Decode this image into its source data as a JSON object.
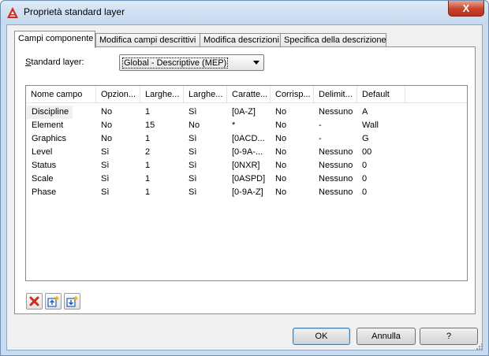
{
  "window": {
    "title": "Proprietà standard layer",
    "close_symbol": "X"
  },
  "tabs": [
    {
      "label": "Campi componente",
      "active": true
    },
    {
      "label": "Modifica campi descrittivi",
      "active": false
    },
    {
      "label": "Modifica descrizioni",
      "active": false
    },
    {
      "label": "Specifica della descrizione",
      "active": false
    }
  ],
  "standard_layer": {
    "label_underlined": "S",
    "label_rest": "tandard layer:",
    "selected": "Global - Descriptive (MEP)"
  },
  "table": {
    "columns": [
      "Nome campo",
      "Opzion...",
      "Larghe...",
      "Larghe...",
      "Caratte...",
      "Corrisp...",
      "Delimit...",
      "Default"
    ],
    "rows": [
      [
        "Discipline",
        "No",
        "1",
        "Sì",
        "[0A-Z]",
        "No",
        "Nessuno",
        "A"
      ],
      [
        "Element",
        "No",
        "15",
        "No",
        "*",
        "No",
        "-",
        "Wall"
      ],
      [
        "Graphics",
        "No",
        "1",
        "Sì",
        "[0ACD...",
        "No",
        "-",
        "G"
      ],
      [
        "Level",
        "Sì",
        "2",
        "Sì",
        "[0-9A-...",
        "No",
        "Nessuno",
        "00"
      ],
      [
        "Status",
        "Sì",
        "1",
        "Sì",
        "[0NXR]",
        "No",
        "Nessuno",
        "0"
      ],
      [
        "Scale",
        "Sì",
        "1",
        "Sì",
        "[0ASPD]",
        "No",
        "Nessuno",
        "0"
      ],
      [
        "Phase",
        "Sì",
        "1",
        "Sì",
        "[0-9A-Z]",
        "No",
        "Nessuno",
        "0"
      ]
    ]
  },
  "toolbar": {
    "icons": [
      "delete-icon",
      "insert-above-icon",
      "insert-below-icon"
    ]
  },
  "buttons": {
    "ok": "OK",
    "cancel": "Annulla",
    "help": "?"
  },
  "colors": {
    "close_button": "#c7432a",
    "delete_icon": "#d42a1e",
    "insert_icon": "#1f5fbf",
    "star_icon": "#f0b400"
  }
}
